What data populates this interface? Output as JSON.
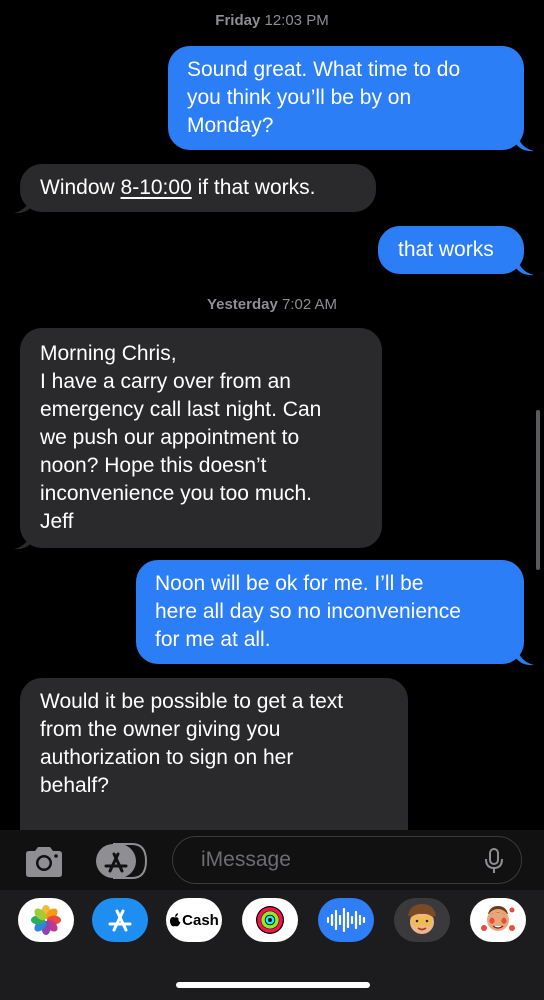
{
  "thread": {
    "messages": [
      {
        "type": "timestamp",
        "day": "Friday",
        "time": "12:03 PM"
      },
      {
        "type": "outgoing",
        "lines": [
          "Sound great. What time to do",
          "you think you’ll be by on",
          "Monday?"
        ]
      },
      {
        "type": "incoming",
        "prefix": "Window ",
        "link": "8-10:00",
        "suffix": " if that works."
      },
      {
        "type": "outgoing",
        "lines": [
          "that works"
        ]
      },
      {
        "type": "timestamp",
        "day": "Yesterday",
        "time": "7:02 AM"
      },
      {
        "type": "incoming",
        "lines": [
          "Morning Chris,",
          "I have a carry over from an",
          "emergency call last night. Can",
          "we push our appointment to",
          "noon? Hope this doesn’t",
          "inconvenience you too much.",
          "Jeff"
        ]
      },
      {
        "type": "outgoing",
        "lines": [
          "Noon will be ok for me. I’ll be",
          "here all day so no inconvenience",
          "for me at all."
        ]
      },
      {
        "type": "incoming",
        "lines": [
          "Would it be possible to get a text",
          "from the owner giving you",
          "authorization to sign on her",
          "behalf?"
        ]
      }
    ]
  },
  "composer": {
    "placeholder": "iMessage",
    "camera_icon": "camera-icon",
    "apps_icon": "app-store-icon",
    "mic_icon": "microphone-icon"
  },
  "app_drawer": {
    "apps": [
      {
        "name": "photos-app",
        "icon": "photos-icon"
      },
      {
        "name": "app-store-app",
        "icon": "app-store-icon"
      },
      {
        "name": "cash-app",
        "label": "Cash",
        "icon": "apple-logo-icon"
      },
      {
        "name": "activity-app",
        "icon": "activity-rings-icon"
      },
      {
        "name": "audio-message-app",
        "icon": "waveform-icon"
      },
      {
        "name": "memoji-app",
        "icon": "memoji-icon"
      },
      {
        "name": "memoji-stickers-app",
        "icon": "memoji-stickers-icon"
      }
    ]
  },
  "colors": {
    "outgoing_bubble": "#2b7ef6",
    "incoming_bubble": "#2a2a2c",
    "timestamp_text": "#8e8e93",
    "background": "#000000"
  }
}
